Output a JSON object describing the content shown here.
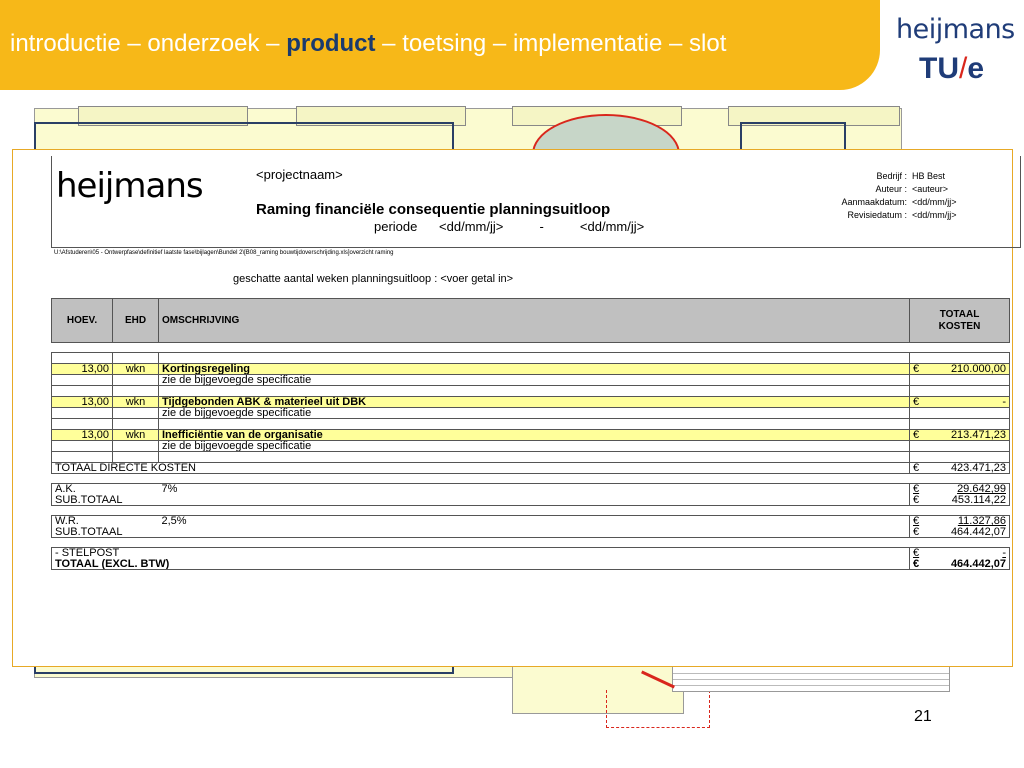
{
  "header": {
    "nav_before": "introductie – onderzoek – ",
    "nav_current": "product",
    "nav_after": " – toetsing – implementatie – slot",
    "logo_heijmans": "heijmans",
    "logo_tue_1": "TU",
    "logo_tue_2": "e"
  },
  "doc": {
    "logo": "heijmans",
    "projectnaam": "<projectnaam>",
    "title": "Raming financiële consequentie planningsuitloop",
    "periode": "periode      <dd/mm/jj>          -          <dd/mm/jj>",
    "meta_labels": [
      "Bedrijf :",
      "Auteur :",
      "Aanmaakdatum:",
      "Revisiedatum :"
    ],
    "meta_values": [
      "HB Best",
      "<auteur>",
      "<dd/mm/jj>",
      "<dd/mm/jj>"
    ],
    "path": "U:\\Afstuderen\\05 - Ontwerpfase\\definitief laatste fase\\bijlagen\\Bundel 2\\[B08_raming bouwtijdoverschrijding.xls]overzicht raming",
    "schatting": "geschatte aantal weken planningsuitloop : <voer getal in>"
  },
  "table": {
    "headers": {
      "hoev": "HOEV.",
      "ehd": "EHD",
      "oms": "OMSCHRIJVING",
      "tot_1": "TOTAAL",
      "tot_2": "KOSTEN"
    },
    "items": [
      {
        "hoev": "13,00",
        "ehd": "wkn",
        "oms": "Kortingsregeling",
        "eur": "€",
        "amount": "210.000,00",
        "spec": "zie de bijgevoegde specificatie"
      },
      {
        "hoev": "13,00",
        "ehd": "wkn",
        "oms": "Tijdgebonden ABK & materieel uit DBK",
        "eur": "€",
        "amount": "-",
        "spec": "zie de bijgevoegde specificatie"
      },
      {
        "hoev": "13,00",
        "ehd": "wkn",
        "oms": "Inefficiëntie van de organisatie",
        "eur": "€",
        "amount": "213.471,23",
        "spec": "zie de bijgevoegde specificatie"
      }
    ],
    "totaal_directe": {
      "label": "TOTAAL DIRECTE KOSTEN",
      "eur": "€",
      "amount": "423.471,23"
    },
    "ak": {
      "label": "A.K.",
      "pct": "7%",
      "eur": "€",
      "amount": "29.642,99"
    },
    "sub1": {
      "label": "SUB.TOTAAL",
      "eur": "€",
      "amount": "453.114,22"
    },
    "wr": {
      "label": "W.R.",
      "pct": "2,5%",
      "eur": "€",
      "amount": "11.327,86"
    },
    "sub2": {
      "label": "SUB.TOTAAL",
      "eur": "€",
      "amount": "464.442,07"
    },
    "stelpost": {
      "label": "- STELPOST",
      "eur": "€",
      "amount": "-"
    },
    "totaal": {
      "label": "TOTAAL (EXCL. BTW)",
      "eur": "€",
      "amount": "464.442,07"
    }
  },
  "slide_number": "21"
}
